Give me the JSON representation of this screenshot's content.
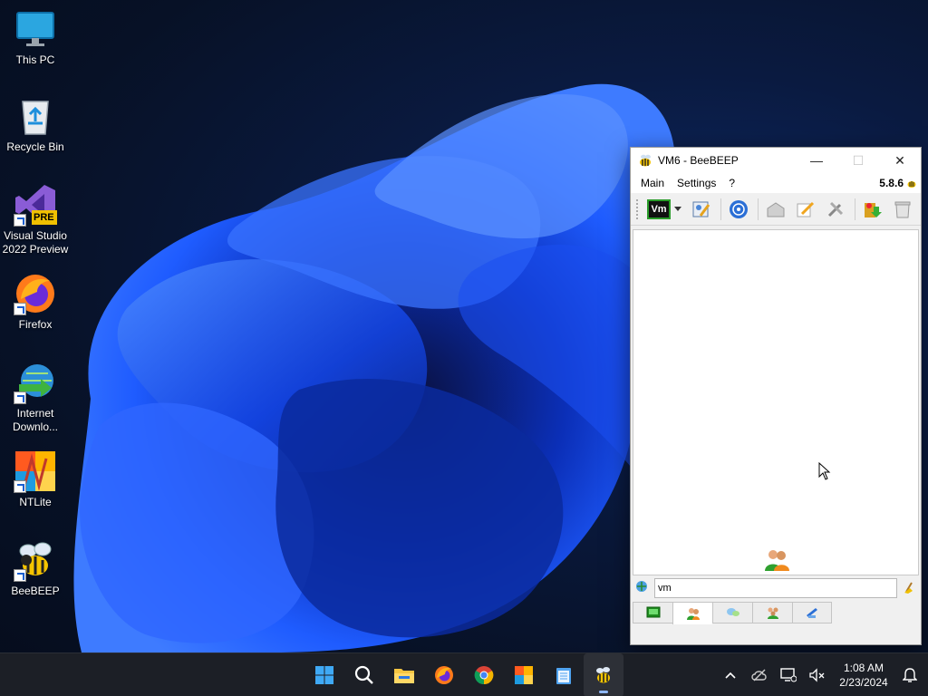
{
  "desktop": {
    "icons": [
      {
        "label": "This PC",
        "icon": "monitor-icon"
      },
      {
        "label": "Recycle Bin",
        "icon": "recycle-bin-icon"
      },
      {
        "label": "Visual Studio 2022 Preview",
        "badge": "PRE",
        "icon": "visual-studio-icon"
      },
      {
        "label": "Firefox",
        "icon": "firefox-icon"
      },
      {
        "label": "Internet Downlo...",
        "icon": "internet-download-manager-icon"
      },
      {
        "label": "NTLite",
        "icon": "ntlite-icon"
      },
      {
        "label": "BeeBEEP",
        "icon": "beebeep-icon"
      }
    ]
  },
  "window": {
    "title": "VM6 - BeeBEEP",
    "version": "5.8.6",
    "menu": [
      "Main",
      "Settings",
      "?"
    ],
    "toolbar": {
      "status_button_label": "Vm",
      "tools": [
        "edit-profile-icon",
        "network-icon",
        "message-icon",
        "pencil-icon",
        "tools-icon",
        "update-icon",
        "trash-icon"
      ]
    },
    "search": {
      "value": "vm"
    },
    "tabs": [
      "screen-tab-icon",
      "users-tab-icon",
      "chats-tab-icon",
      "groups-tab-icon",
      "shares-tab-icon"
    ]
  },
  "taskbar": {
    "apps": [
      "start-icon",
      "search-icon",
      "file-explorer-icon",
      "firefox-icon",
      "chrome-icon",
      "ntlite-icon",
      "notepad-icon",
      "beebeep-icon"
    ],
    "clock": {
      "time": "1:08 AM",
      "date": "2/23/2024"
    }
  },
  "colors": {
    "wallpaper_accent": "#1a4fff",
    "taskbar_bg": "#1c1f26",
    "vm_border": "#2a9d2a"
  }
}
